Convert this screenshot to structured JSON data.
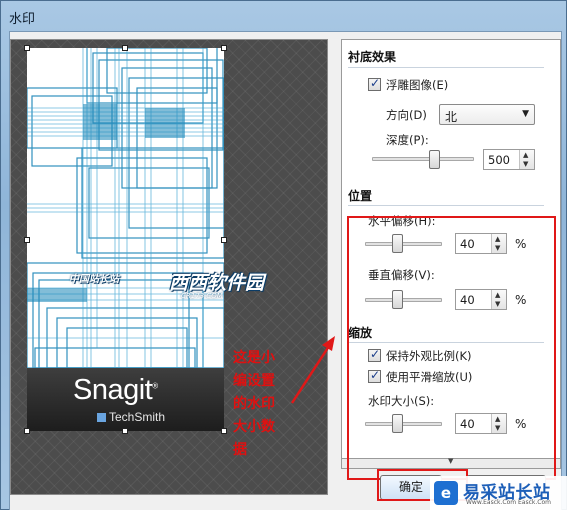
{
  "window": {
    "title": "水印"
  },
  "preview": {
    "product_name": "Snagit",
    "product_mark": "®",
    "company": "TechSmith",
    "watermark": {
      "logo": "中国站长站",
      "name": "西西软件园",
      "url": "CR173.COM"
    }
  },
  "annotation": {
    "text": "这是小编设置的水印大小数据"
  },
  "options": {
    "background_effect": {
      "title": "衬底效果",
      "emboss_label": "浮雕图像(E)",
      "emboss_checked": true,
      "direction_label": "方向(D)",
      "direction_value": "北",
      "depth_label": "深度(P):",
      "depth_value": "500",
      "depth_level": 0.45
    },
    "position": {
      "title": "位置",
      "h_offset_label": "水平偏移(H):",
      "h_offset_value": "40",
      "v_offset_label": "垂直偏移(V):",
      "v_offset_value": "40",
      "unit": "%"
    },
    "scale": {
      "title": "缩放",
      "keep_aspect_label": "保持外观比例(K)",
      "keep_aspect_checked": true,
      "smooth_label": "使用平滑缩放(U)",
      "smooth_checked": true,
      "size_label": "水印大小(S):",
      "size_value": "40",
      "unit": "%"
    }
  },
  "footer": {
    "ok_label": "确定"
  },
  "site_badge": {
    "name": "易采站长站",
    "url": "Www.Easck.Com  Easck.Com"
  },
  "colors": {
    "accent_red": "#e01818",
    "title_bar": "#a9c8e4",
    "preview_bg": "#4c4c4c",
    "line_blue": "#1b86b8"
  }
}
